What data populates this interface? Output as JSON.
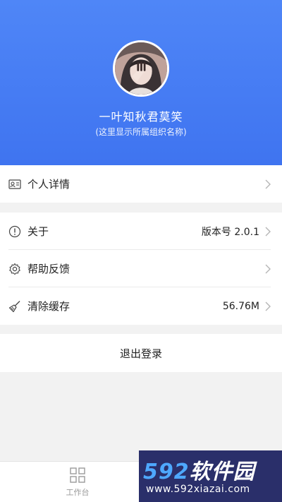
{
  "profile": {
    "name": "一叶知秋君莫笑",
    "org": "(这里显示所属组织名称)"
  },
  "menu": {
    "personal_details": {
      "label": "个人详情",
      "icon": "id-card-icon"
    },
    "about": {
      "label": "关于",
      "value": "版本号 2.0.1",
      "icon": "info-icon"
    },
    "help": {
      "label": "帮助反馈",
      "icon": "gear-icon"
    },
    "clear_cache": {
      "label": "清除缓存",
      "value": "56.76M",
      "icon": "broom-icon"
    }
  },
  "logout": {
    "label": "退出登录"
  },
  "tabbar": {
    "tabs": [
      {
        "label": "工作台",
        "icon": "grid-icon"
      }
    ]
  },
  "watermark": {
    "brand_num": "592",
    "brand_text": "软件园",
    "url": "www.592xiazai.com"
  },
  "colors": {
    "header": "#4a7ff5",
    "background": "#f2f2f2",
    "watermark": "#2a2f6a"
  }
}
